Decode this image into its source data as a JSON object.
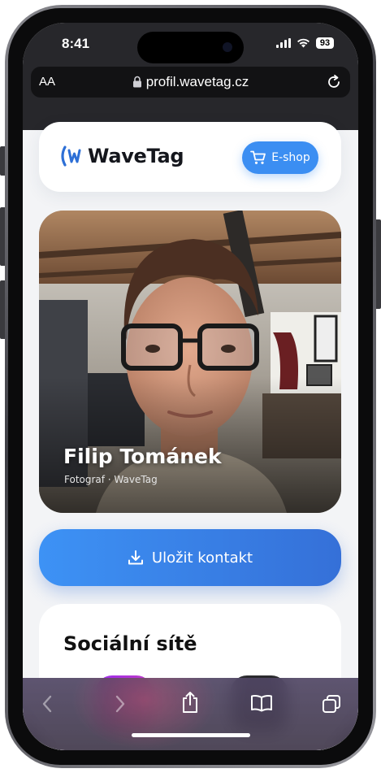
{
  "status_bar": {
    "time": "8:41",
    "battery": "93"
  },
  "browser": {
    "text_size": "AA",
    "url": "profil.wavetag.cz"
  },
  "header": {
    "brand": "WaveTag",
    "eshop_label": "E-shop"
  },
  "profile": {
    "name": "Filip Tománek",
    "role": "Fotograf · WaveTag"
  },
  "actions": {
    "save_contact": "Uložit kontakt"
  },
  "social": {
    "title": "Sociální sítě"
  },
  "colors": {
    "accent": "#3b8ef2",
    "brand_mark": "#2d6fd6"
  }
}
